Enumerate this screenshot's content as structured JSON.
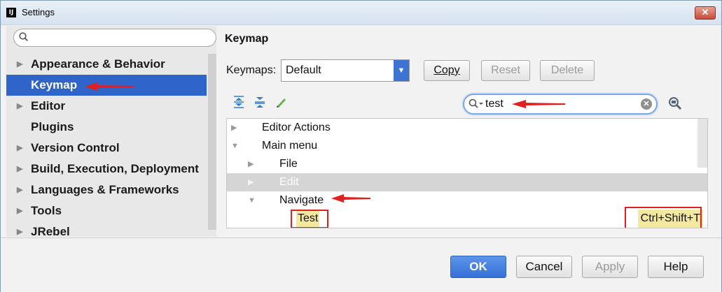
{
  "window": {
    "title": "Settings",
    "app_icon": "IJ",
    "close_glyph": "✕"
  },
  "sidebar": {
    "search_placeholder": "",
    "items": [
      {
        "label": "Appearance & Behavior",
        "expandable": true
      },
      {
        "label": "Keymap",
        "expandable": false,
        "selected": true
      },
      {
        "label": "Editor",
        "expandable": true
      },
      {
        "label": "Plugins",
        "expandable": false
      },
      {
        "label": "Version Control",
        "expandable": true
      },
      {
        "label": "Build, Execution, Deployment",
        "expandable": true
      },
      {
        "label": "Languages & Frameworks",
        "expandable": true
      },
      {
        "label": "Tools",
        "expandable": true
      },
      {
        "label": "JRebel",
        "expandable": true
      }
    ]
  },
  "main": {
    "heading": "Keymap",
    "keymaps_label": "Keymaps:",
    "keymaps_value": "Default",
    "buttons": {
      "copy": "Copy",
      "reset": "Reset",
      "delete": "Delete"
    },
    "toolbar_icons": [
      "expand-all-icon",
      "collapse-all-icon",
      "edit-pencil-icon"
    ],
    "filter_value": "test",
    "tree": [
      {
        "label": "Editor Actions",
        "state": "collapsed"
      },
      {
        "label": "Main menu",
        "state": "expanded"
      },
      {
        "label": "File",
        "state": "collapsed"
      },
      {
        "label": "Edit",
        "state": "collapsed"
      },
      {
        "label": "Navigate",
        "state": "expanded"
      },
      {
        "label": "Test",
        "shortcut": "Ctrl+Shift+T"
      }
    ]
  },
  "footer": {
    "ok": "OK",
    "cancel": "Cancel",
    "apply": "Apply",
    "help": "Help"
  },
  "colors": {
    "selection": "#2f65ca",
    "primary_button": "#3470d7",
    "annotation": "#e02020",
    "match_highlight": "#f3e89d"
  }
}
